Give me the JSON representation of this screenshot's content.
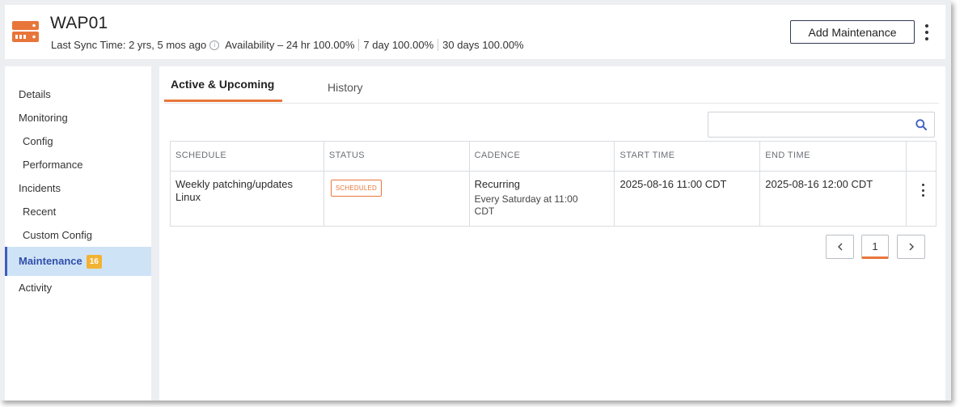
{
  "header": {
    "title": "WAP01",
    "last_sync": "Last Sync Time: 2 yrs, 5 mos ago",
    "availability": "Availability – 24 hr 100.00%",
    "seven_day": "7 day 100.00%",
    "thirty_day": "30 days 100.00%",
    "add_button": "Add Maintenance",
    "icon": "server-icon",
    "accent_color": "#e8763a"
  },
  "sidebar": {
    "items": [
      {
        "label": "Details"
      },
      {
        "label": "Monitoring"
      },
      {
        "label": "Config"
      },
      {
        "label": "Performance"
      },
      {
        "label": "Incidents"
      },
      {
        "label": "Recent"
      },
      {
        "label": "Custom Config"
      },
      {
        "label": "Maintenance",
        "badge": "16"
      },
      {
        "label": "Activity"
      }
    ],
    "active_color": "#cfe3f7",
    "badge_color": "#f2b233"
  },
  "tabs": [
    {
      "label": "Active & Upcoming"
    },
    {
      "label": "History"
    }
  ],
  "search": {
    "placeholder": "",
    "value": ""
  },
  "table": {
    "headers": [
      "SCHEDULE",
      "STATUS",
      "CADENCE",
      "START TIME",
      "END TIME"
    ],
    "rows": [
      {
        "schedule": "Weekly patching/updates Linux",
        "status": "SCHEDULED",
        "cadence": "Recurring",
        "cadence_detail": "Every Saturday at 11:00 CDT",
        "start": "2025-08-16 11:00 CDT",
        "end": "2025-08-16 12:00 CDT"
      }
    ]
  },
  "pagination": {
    "current": "1"
  }
}
